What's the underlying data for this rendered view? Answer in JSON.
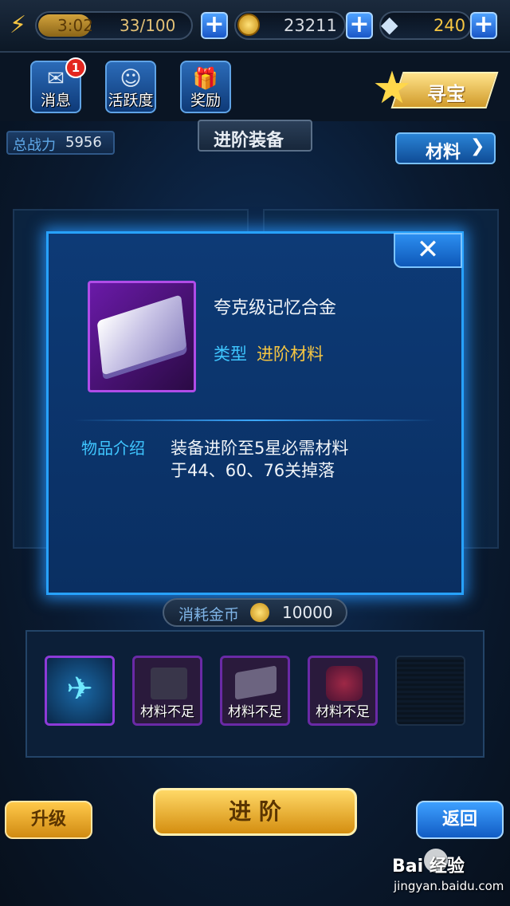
{
  "top_bar": {
    "energy_time": "3:02",
    "energy_count": "33/100",
    "gold": "23211",
    "diamond": "240"
  },
  "nav": {
    "messages_label": "消息",
    "messages_badge": "1",
    "activity_label": "活跃度",
    "rewards_label": "奖励",
    "treasure_label": "寻宝"
  },
  "panel": {
    "power_label": "总战力",
    "power_value": "5956",
    "title": "进阶装备",
    "materials_button": "材料"
  },
  "modal": {
    "item_name": "夸克级记忆合金",
    "type_label": "类型",
    "type_value": "进阶材料",
    "desc_label": "物品介绍",
    "desc_line1": "装备进阶至5星必需材料",
    "desc_line2": "于44、60、76关掉落",
    "close_icon": "close-icon"
  },
  "cost": {
    "label": "消耗金币",
    "value": "10000"
  },
  "slots": [
    {
      "status": ""
    },
    {
      "status": "材料不足"
    },
    {
      "status": "材料不足"
    },
    {
      "status": "材料不足"
    },
    {
      "status": ""
    }
  ],
  "actions": {
    "upgrade": "升级",
    "advance": "进 阶",
    "back": "返回"
  },
  "watermark": {
    "brand": "Bai 经验",
    "url": "jingyan.baidu.com"
  },
  "colors": {
    "accent_blue": "#27a2ff",
    "gold_text": "#f5c542",
    "type_cyan": "#3fc6ff",
    "purple_rarity": "#b04ce8"
  }
}
